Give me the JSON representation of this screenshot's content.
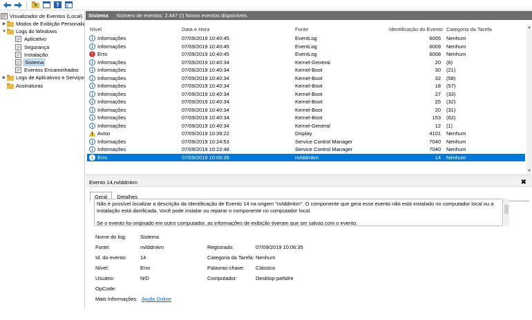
{
  "toolbar": {
    "icons": [
      "back-arrow-icon",
      "forward-arrow-icon",
      "folder-icon",
      "panel-icon",
      "help-icon",
      "panel-icon-2"
    ]
  },
  "tree": {
    "root": "Visualizador de Eventos (Local)",
    "items": [
      {
        "label": "Modos de Exibição Personalizados",
        "indent": 1,
        "twisty": "▶"
      },
      {
        "label": "Logs do Windows",
        "indent": 1,
        "twisty": "▼"
      },
      {
        "label": "Aplicativo",
        "indent": 2,
        "twisty": ""
      },
      {
        "label": "Segurança",
        "indent": 2,
        "twisty": ""
      },
      {
        "label": "Instalação",
        "indent": 2,
        "twisty": ""
      },
      {
        "label": "Sistema",
        "indent": 2,
        "twisty": "",
        "selected": true
      },
      {
        "label": "Eventos Encaminhados",
        "indent": 2,
        "twisty": ""
      },
      {
        "label": "Logs de Aplicativos e Serviços",
        "indent": 1,
        "twisty": "▶"
      },
      {
        "label": "Assinaturas",
        "indent": 1,
        "twisty": ""
      }
    ]
  },
  "header": {
    "title": "Sistema",
    "subtitle": "Número de eventos: 2.447 (!) Novos eventos disponíveis"
  },
  "columns": [
    "Nível",
    "Data e Hora",
    "Fonte",
    "Identificação do Evento",
    "Categoria da Tarefa"
  ],
  "events": [
    {
      "level": "Informações",
      "icon": "info",
      "datetime": "07/09/2019 10:40:45",
      "source": "EventLog",
      "id": "6005",
      "category": "Nenhum"
    },
    {
      "level": "Informações",
      "icon": "info",
      "datetime": "07/09/2019 10:40:45",
      "source": "EventLog",
      "id": "6009",
      "category": "Nenhum"
    },
    {
      "level": "Erro",
      "icon": "error",
      "datetime": "07/09/2019 10:40:45",
      "source": "EventLog",
      "id": "6008",
      "category": "Nenhum"
    },
    {
      "level": "Informações",
      "icon": "info",
      "datetime": "07/09/2019 10:40:34",
      "source": "Kernel-General",
      "id": "20",
      "category": "(6)"
    },
    {
      "level": "Informações",
      "icon": "info",
      "datetime": "07/09/2019 10:40:34",
      "source": "Kernel-Boot",
      "id": "30",
      "category": "(21)"
    },
    {
      "level": "Informações",
      "icon": "info",
      "datetime": "07/09/2019 10:40:34",
      "source": "Kernel-Boot",
      "id": "32",
      "category": "(58)"
    },
    {
      "level": "Informações",
      "icon": "info",
      "datetime": "07/09/2019 10:40:34",
      "source": "Kernel-Boot",
      "id": "18",
      "category": "(57)"
    },
    {
      "level": "Informações",
      "icon": "info",
      "datetime": "07/09/2019 10:40:34",
      "source": "Kernel-Boot",
      "id": "27",
      "category": "(33)"
    },
    {
      "level": "Informações",
      "icon": "info",
      "datetime": "07/09/2019 10:40:34",
      "source": "Kernel-Boot",
      "id": "25",
      "category": "(32)"
    },
    {
      "level": "Informações",
      "icon": "info",
      "datetime": "07/09/2019 10:40:34",
      "source": "Kernel-Boot",
      "id": "20",
      "category": "(31)"
    },
    {
      "level": "Informações",
      "icon": "info",
      "datetime": "07/09/2019 10:40:34",
      "source": "Kernel-Boot",
      "id": "153",
      "category": "(62)"
    },
    {
      "level": "Informações",
      "icon": "info",
      "datetime": "07/09/2019 10:40:34",
      "source": "Kernel-General",
      "id": "12",
      "category": "(1)"
    },
    {
      "level": "Aviso",
      "icon": "warning",
      "datetime": "07/09/2019 10:39:22",
      "source": "Display",
      "id": "4101",
      "category": "Nenhum"
    },
    {
      "level": "Informações",
      "icon": "info",
      "datetime": "07/09/2019 10:24:53",
      "source": "Service Control Manager",
      "id": "7040",
      "category": "Nenhum"
    },
    {
      "level": "Informações",
      "icon": "info",
      "datetime": "07/09/2019 10:22:48",
      "source": "Service Control Manager",
      "id": "7040",
      "category": "Nenhum"
    },
    {
      "level": "Erro",
      "icon": "error-selected",
      "datetime": "07/09/2019 10:06:35",
      "source": "nvlddmkm",
      "id": "14",
      "category": "Nenhum",
      "selected": true
    }
  ],
  "event_panel": {
    "title": "Evento 14,nvlddmkm",
    "close": "✖",
    "tabs": [
      "Geral",
      "Detalhes"
    ],
    "description": [
      "Não é possível localizar a descrição da Identificação de Evento 14 na origem \"nvlddmkm\". O componente que gera esse evento não está instalado no computador local ou a instalação está danificada. Você pode instalar ou reparar o componente no computador local.",
      "Se o evento foi originado em outro computador, as informações de exibição tiveram que ser salvas com o evento."
    ],
    "props": {
      "log_name_label": "Nome do log:",
      "log_name": "Sistema",
      "source_label": "Fonte:",
      "source": "nvlddmkm",
      "logged_label": "Registrado:",
      "logged": "07/09/2019 10:06:35",
      "event_id_label": "Id. do evento:",
      "event_id": "14",
      "category_label": "Categoria da Tarefa:",
      "category": "Nenhum",
      "level_label": "Nível:",
      "level": "Erro",
      "keywords_label": "Palavras-chave:",
      "keywords": "Clássico",
      "user_label": "Usuário:",
      "user": "N/D",
      "computer_label": "Computador:",
      "computer": "Desktop-paNdre",
      "opcode_label": "OpCode:",
      "more_info_label": "Mais Informações:",
      "more_info_link": "Ajuda Online"
    }
  },
  "colors": {
    "selection": "#0078d7",
    "header_bar": "#6d6d6d",
    "info_icon": "#2b6cb0",
    "error_icon": "#d32f2f",
    "warning_icon": "#f2c811"
  }
}
